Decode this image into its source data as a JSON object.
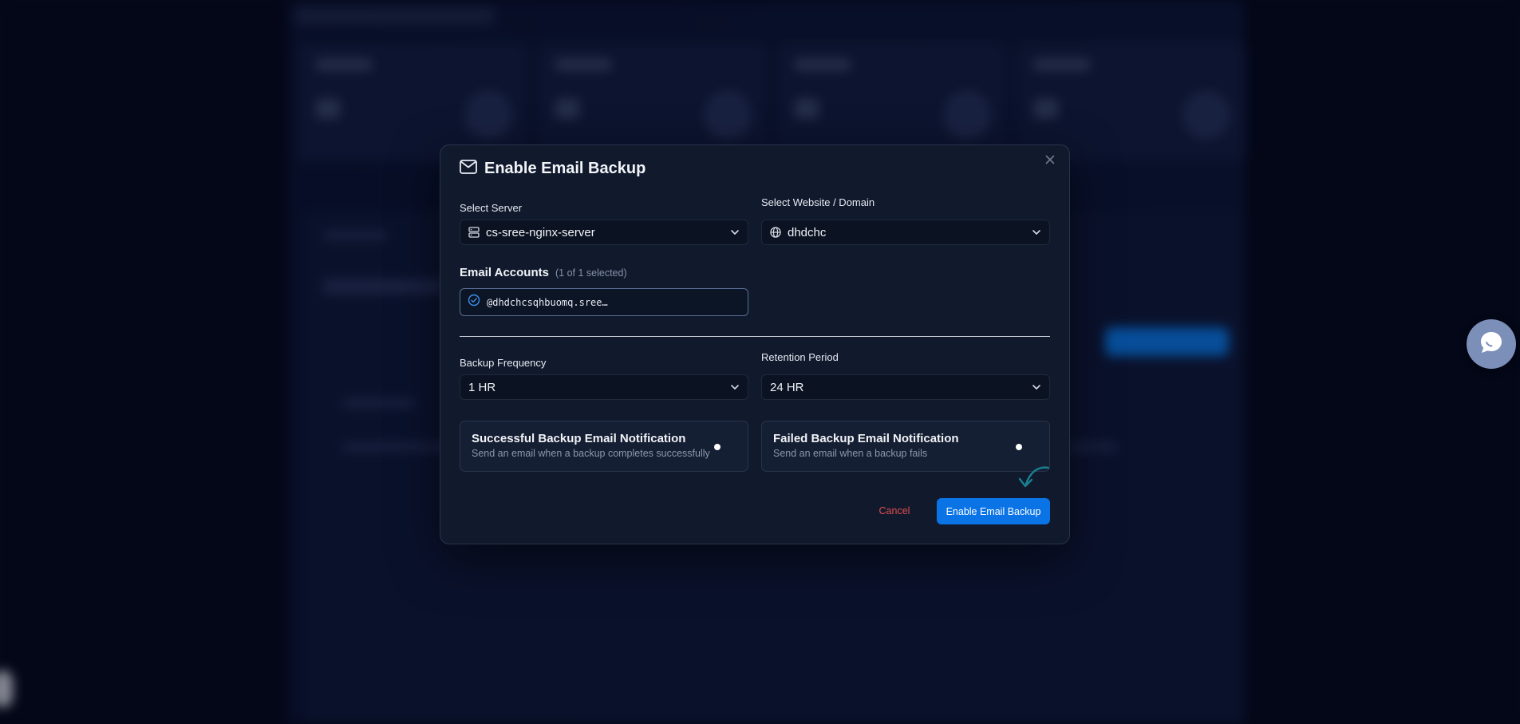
{
  "modal": {
    "title": "Enable Email Backup",
    "icon": "mail-icon",
    "close_icon": "close-icon"
  },
  "server": {
    "label": "Select Server",
    "value": "cs-sree-nginx-server",
    "icon": "server-icon"
  },
  "website": {
    "label": "Select Website / Domain",
    "value": "dhdchc",
    "icon": "globe-icon"
  },
  "email_accounts": {
    "title": "Email Accounts",
    "count_text": "(1 of 1 selected)",
    "items": [
      {
        "address": "@dhdchcsqhbuomq.sree…",
        "selected": true
      }
    ]
  },
  "backup_frequency": {
    "label": "Backup Frequency",
    "value": "1 HR"
  },
  "retention_period": {
    "label": "Retention Period",
    "value": "24 HR"
  },
  "notifications": {
    "success": {
      "title": "Successful Backup Email Notification",
      "description": "Send an email when a backup completes successfully"
    },
    "failed": {
      "title": "Failed Backup Email Notification",
      "description": "Send an email when a backup fails"
    }
  },
  "actions": {
    "cancel_label": "Cancel",
    "confirm_label": "Enable Email Backup"
  },
  "colors": {
    "primary": "#0a74e6",
    "cancel": "#e24d4d",
    "modal_bg": "#111a2d",
    "page_bg": "#050a1c"
  }
}
